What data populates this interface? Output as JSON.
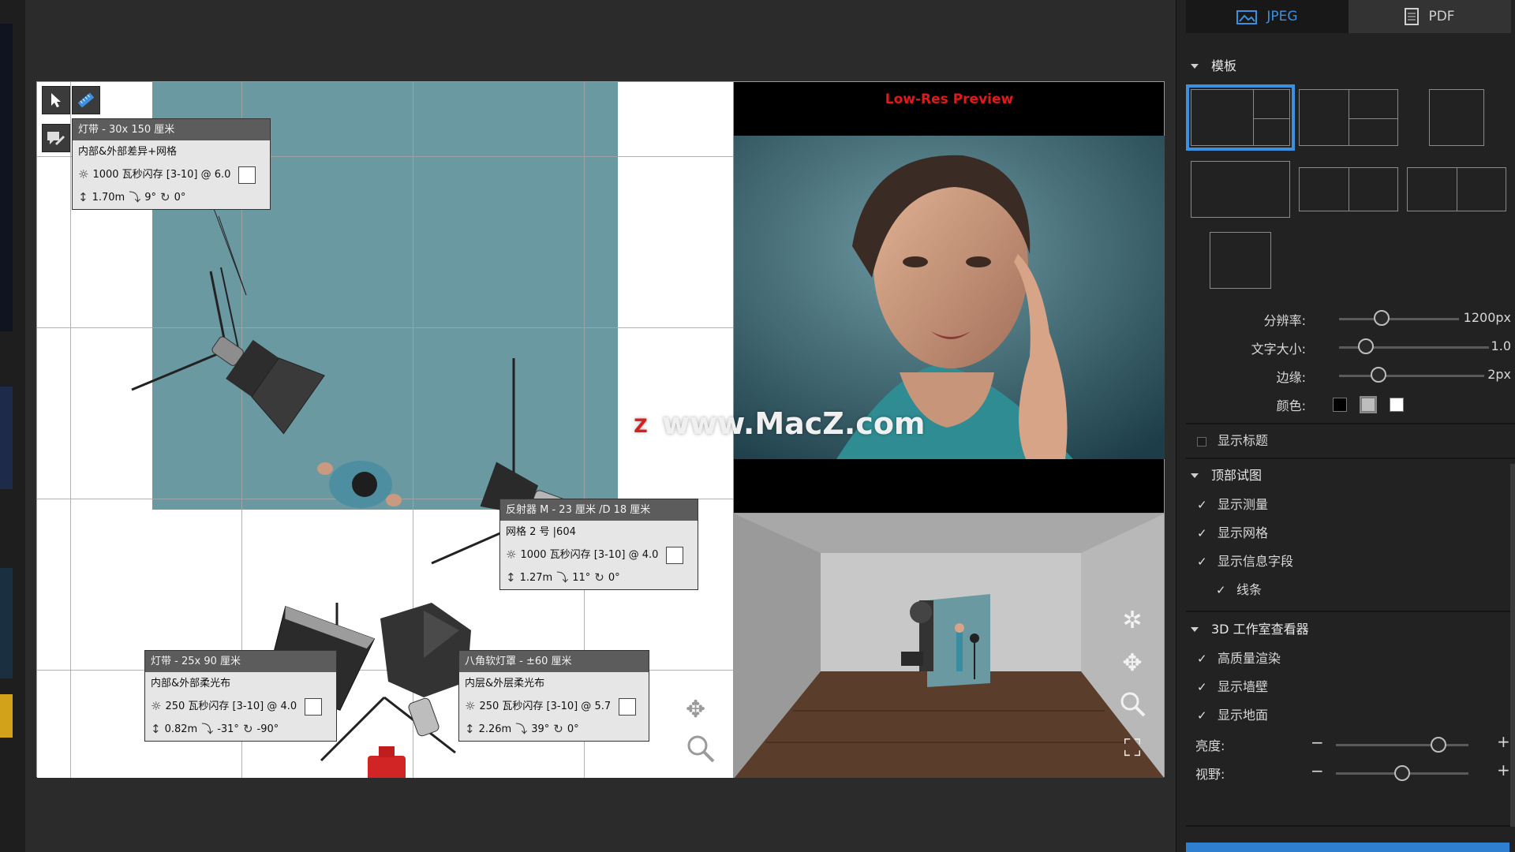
{
  "format_tabs": [
    {
      "label": "JPEG",
      "icon": "image-icon",
      "active": true
    },
    {
      "label": "PDF",
      "icon": "document-icon",
      "active": false
    }
  ],
  "templates_section": {
    "title": "模板"
  },
  "sliders": {
    "resolution": {
      "label": "分辨率:",
      "value": "1200px",
      "level": 0.33
    },
    "text_size": {
      "label": "文字大小:",
      "value": "1.0",
      "level": 0.17
    },
    "border": {
      "label": "边缘:",
      "value": "2px",
      "level": 0.27
    }
  },
  "colors": {
    "label": "颜色:",
    "options": [
      "#000000",
      "#bdbdbd",
      "#ffffff"
    ],
    "selected": 1
  },
  "show_title": {
    "label": "显示标题",
    "checked": false
  },
  "top_view": {
    "title": "顶部试图",
    "items": [
      {
        "label": "显示测量",
        "checked": true
      },
      {
        "label": "显示网格",
        "checked": true
      },
      {
        "label": "显示信息字段",
        "checked": true
      },
      {
        "label": "线条",
        "checked": true
      }
    ]
  },
  "viewer3d": {
    "title": "3D 工作室查看器",
    "items": [
      {
        "label": "高质量渲染",
        "checked": true
      },
      {
        "label": "显示墙壁",
        "checked": true
      },
      {
        "label": "显示地面",
        "checked": true
      }
    ],
    "brightness": {
      "label": "亮度:",
      "minus": "−",
      "plus": "+",
      "level": 0.79
    },
    "fov": {
      "label": "视野:",
      "minus": "−",
      "plus": "+",
      "level": 0.5
    }
  },
  "preview": {
    "label": "Low-Res Preview"
  },
  "watermark": {
    "badge": "Z",
    "text": "www.MacZ.com"
  },
  "info_boxes": {
    "box1": {
      "title": "灯带 - 30x 150 厘米",
      "modifier": "内部&外部差异+网格",
      "power": "1000 瓦秒闪存 [3-10] @ 6.0",
      "height": "1.70m",
      "tilt": "9°",
      "rotate": "0°"
    },
    "box2": {
      "title": "反射器 M - 23 厘米 /D 18 厘米",
      "modifier": "网格 2 号 |604",
      "power": "1000 瓦秒闪存 [3-10] @ 4.0",
      "height": "1.27m",
      "tilt": "11°",
      "rotate": "0°"
    },
    "box3": {
      "title": "灯带 - 25x 90 厘米",
      "modifier": "内部&外部柔光布",
      "power": "250 瓦秒闪存 [3-10] @ 4.0",
      "height": "0.82m",
      "tilt": "-31°",
      "rotate": "-90°"
    },
    "box4": {
      "title": "八角软灯罩 - ±60 厘米",
      "modifier": "内层&外层柔光布",
      "power": "250 瓦秒闪存 [3-10] @ 5.7",
      "height": "2.26m",
      "tilt": "39°",
      "rotate": "0°"
    }
  },
  "accent": {
    "blue": "#3d8fe0",
    "preview_red": "#e01a1a",
    "backdrop": "#6a99a2"
  }
}
